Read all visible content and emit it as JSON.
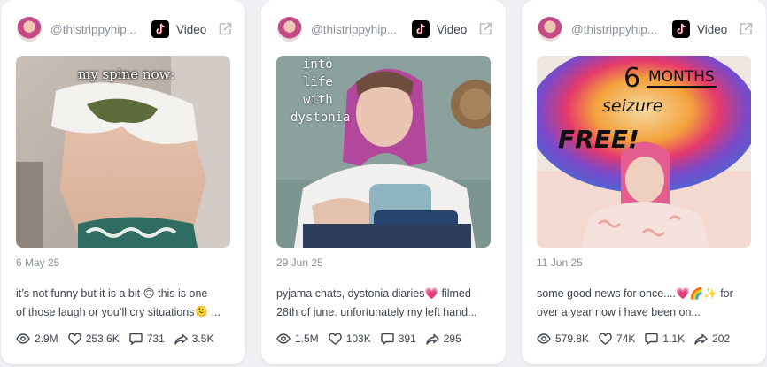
{
  "cards": [
    {
      "handle": "@thistrippyhip...",
      "type_label": "Video",
      "overlay_text": "my spine now:",
      "date": "6 May 25",
      "caption_line1": "it’s not funny but it is a bit 🙃 this is one",
      "caption_line2": "of those laugh or you’ll cry situations🫠 ...",
      "views": "2.9M",
      "likes": "253.6K",
      "comments": "731",
      "shares": "3.5K"
    },
    {
      "handle": "@thistrippyhip...",
      "type_label": "Video",
      "overlay_text_lines": [
        "into",
        "life",
        "with",
        "dystonia"
      ],
      "date": "29 Jun 25",
      "caption_line1": "pyjama chats, dystonia diaries💗 filmed",
      "caption_line2": "28th of june. unfortunately my left hand...",
      "views": "1.5M",
      "likes": "103K",
      "comments": "391",
      "shares": "295"
    },
    {
      "handle": "@thistrippyhip...",
      "type_label": "Video",
      "overlay_text_lines": [
        "6",
        "MONTHS",
        "seizure",
        "FREE!"
      ],
      "date": "11 Jun 25",
      "caption_line1": "some good news for once....💗🌈✨ for",
      "caption_line2": "over a year now i have been on...",
      "views": "579.8K",
      "likes": "74K",
      "comments": "1.1K",
      "shares": "202"
    }
  ],
  "icons": {
    "views": "eye-icon",
    "likes": "heart-icon",
    "comments": "comment-icon",
    "shares": "share-icon",
    "external": "external-link-icon",
    "platform": "tiktok-icon"
  }
}
